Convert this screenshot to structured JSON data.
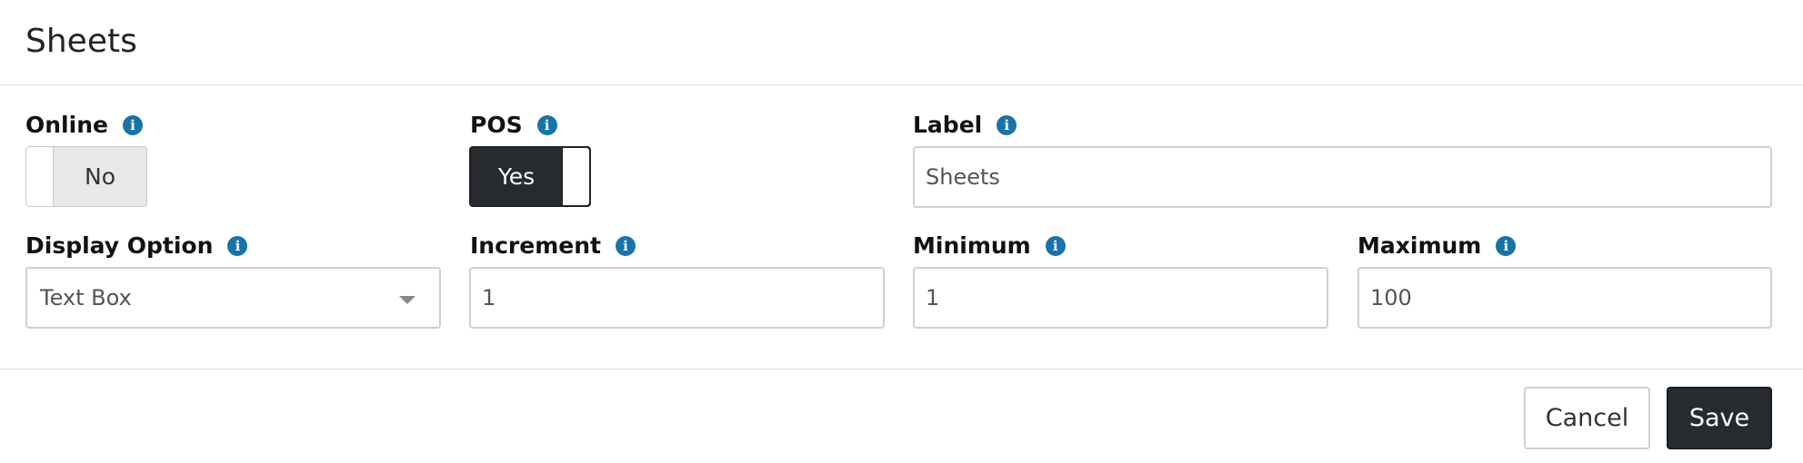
{
  "header": {
    "title": "Sheets"
  },
  "fields": {
    "online": {
      "label": "Online",
      "toggle_text": "No",
      "state": "off"
    },
    "pos": {
      "label": "POS",
      "toggle_text": "Yes",
      "state": "on"
    },
    "label": {
      "label": "Label",
      "value": "Sheets"
    },
    "display_option": {
      "label": "Display Option",
      "value": "Text Box"
    },
    "increment": {
      "label": "Increment",
      "value": "1"
    },
    "minimum": {
      "label": "Minimum",
      "value": "1"
    },
    "maximum": {
      "label": "Maximum",
      "value": "100"
    }
  },
  "info_icon": {
    "icon": "info-icon",
    "glyph": "i",
    "color": "#1a73a8"
  },
  "footer": {
    "cancel_label": "Cancel",
    "save_label": "Save"
  },
  "colors": {
    "primary_button": "#272b30",
    "border": "#cfcfcf"
  }
}
